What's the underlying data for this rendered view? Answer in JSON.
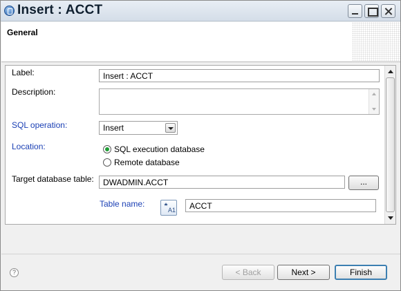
{
  "window": {
    "title": "Insert : ACCT"
  },
  "banner": {
    "title": "General"
  },
  "form": {
    "label": {
      "label": "Label:",
      "value": "Insert : ACCT"
    },
    "description": {
      "label": "Description:",
      "value": ""
    },
    "sql_operation": {
      "label": "SQL operation:",
      "selected": "Insert"
    },
    "location": {
      "label": "Location:",
      "options": [
        {
          "label": "SQL execution database",
          "checked": true
        },
        {
          "label": "Remote database",
          "checked": false
        }
      ]
    },
    "target_table": {
      "label": "Target database table:",
      "value": "DWADMIN.ACCT",
      "browse_label": "..."
    },
    "table_name": {
      "label": "Table name:",
      "value": "ACCT",
      "icon": "sort-columns-icon"
    }
  },
  "footer": {
    "back_label": "< Back",
    "next_label": "Next >",
    "finish_label": "Finish",
    "help_icon": "?"
  },
  "colors": {
    "link_label": "#1a3fb4",
    "radio_checked": "#1f9d35",
    "default_button_border": "#3c7fb1"
  }
}
